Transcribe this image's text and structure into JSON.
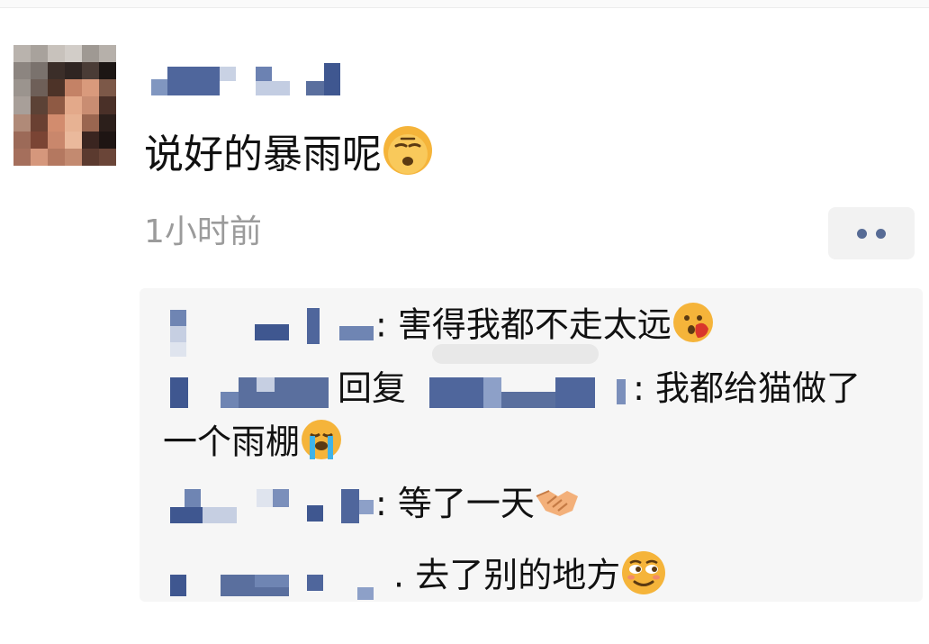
{
  "post": {
    "author_name": "",
    "text": "说好的暴雨呢",
    "emoji": "relieved-sleepy-face-emoji",
    "time": "1小时前"
  },
  "actions": {
    "more": "more-options-icon"
  },
  "comments": [
    {
      "author": "",
      "separator": ":",
      "text": "害得我都不走太远",
      "emoji": "hushed-face-hand-over-mouth-emoji"
    },
    {
      "author": "",
      "reply_word": "回复",
      "reply_to": "",
      "separator": ":",
      "text_line1": "我都给猫做了",
      "text_line2": "一个雨棚",
      "emoji": "loudly-crying-face-emoji"
    },
    {
      "author": "",
      "separator": ":",
      "text": "等了一天",
      "emoji": "handshake-emoji"
    },
    {
      "author": "",
      "separator": ".",
      "text": "去了别的地方",
      "emoji": "smirking-face-emoji"
    }
  ],
  "colors": {
    "link_blue": "#576b95",
    "time_gray": "#9b9b9b",
    "comment_bg": "#f6f6f6"
  }
}
